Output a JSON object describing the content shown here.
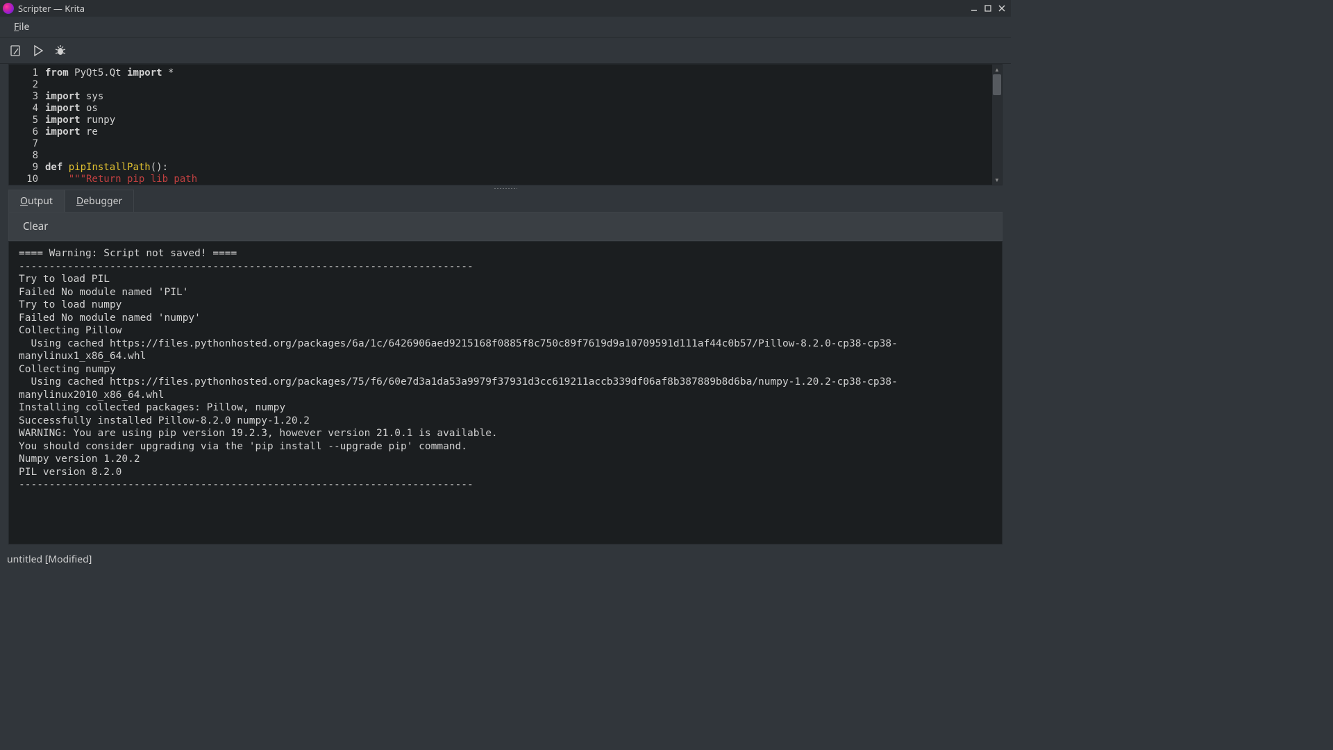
{
  "window": {
    "title": "Scripter — Krita"
  },
  "menu": {
    "file": "File"
  },
  "editor": {
    "lines": [
      {
        "n": 1,
        "segs": [
          {
            "t": "from",
            "c": "kw"
          },
          {
            "t": " PyQt5.Qt ",
            "c": ""
          },
          {
            "t": "import",
            "c": "kw"
          },
          {
            "t": " *",
            "c": ""
          }
        ]
      },
      {
        "n": 2,
        "segs": []
      },
      {
        "n": 3,
        "segs": [
          {
            "t": "import",
            "c": "kw"
          },
          {
            "t": " sys",
            "c": ""
          }
        ]
      },
      {
        "n": 4,
        "segs": [
          {
            "t": "import",
            "c": "kw"
          },
          {
            "t": " os",
            "c": ""
          }
        ]
      },
      {
        "n": 5,
        "segs": [
          {
            "t": "import",
            "c": "kw"
          },
          {
            "t": " runpy",
            "c": ""
          }
        ]
      },
      {
        "n": 6,
        "segs": [
          {
            "t": "import",
            "c": "kw"
          },
          {
            "t": " re",
            "c": ""
          }
        ]
      },
      {
        "n": 7,
        "segs": []
      },
      {
        "n": 8,
        "segs": []
      },
      {
        "n": 9,
        "segs": [
          {
            "t": "def",
            "c": "kw"
          },
          {
            "t": " ",
            "c": ""
          },
          {
            "t": "pipInstallPath",
            "c": "fn"
          },
          {
            "t": "():",
            "c": ""
          }
        ]
      },
      {
        "n": 10,
        "segs": [
          {
            "t": "    ",
            "c": ""
          },
          {
            "t": "\"\"\"Return pip lib path",
            "c": "str"
          }
        ]
      }
    ]
  },
  "tabs": {
    "output": "Output",
    "debugger": "Debugger"
  },
  "clear_label": "Clear",
  "output_text": "==== Warning: Script not saved! ====\n---------------------------------------------------------------------------\nTry to load PIL\nFailed No module named 'PIL'\nTry to load numpy\nFailed No module named 'numpy'\nCollecting Pillow\n  Using cached https://files.pythonhosted.org/packages/6a/1c/6426906aed9215168f0885f8c750c89f7619d9a10709591d111af44c0b57/Pillow-8.2.0-cp38-cp38-manylinux1_x86_64.whl\nCollecting numpy\n  Using cached https://files.pythonhosted.org/packages/75/f6/60e7d3a1da53a9979f37931d3cc619211accb339df06af8b387889b8d6ba/numpy-1.20.2-cp38-cp38-manylinux2010_x86_64.whl\nInstalling collected packages: Pillow, numpy\nSuccessfully installed Pillow-8.2.0 numpy-1.20.2\nWARNING: You are using pip version 19.2.3, however version 21.0.1 is available.\nYou should consider upgrading via the 'pip install --upgrade pip' command.\nNumpy version 1.20.2\nPIL version 8.2.0\n---------------------------------------------------------------------------",
  "status": "untitled [Modified]"
}
